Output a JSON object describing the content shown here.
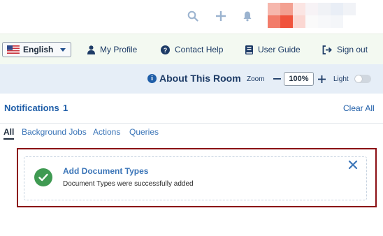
{
  "topbar": {
    "icons": [
      "search-icon",
      "plus-icon",
      "bell-icon"
    ],
    "avatar": "user-avatar"
  },
  "nav": {
    "language": "English",
    "language_flag": "us-flag-icon",
    "items": [
      {
        "label": "My Profile",
        "icon": "person-icon"
      },
      {
        "label": "Contact Help",
        "icon": "help-icon"
      },
      {
        "label": "User Guide",
        "icon": "book-icon"
      },
      {
        "label": "Sign out",
        "icon": "sign-out-icon"
      }
    ]
  },
  "room": {
    "about_label": "About This Room",
    "zoom_label": "Zoom",
    "zoom_value": "100%",
    "light_label": "Light",
    "light_on": false
  },
  "notifications": {
    "title": "Notifications",
    "count": "1",
    "clear_all": "Clear All",
    "tabs": [
      {
        "label": "All",
        "active": true
      },
      {
        "label": "Background Jobs",
        "active": false
      },
      {
        "label": "Actions",
        "active": false
      },
      {
        "label": "Queries",
        "active": false
      }
    ],
    "items": [
      {
        "title": "Add Document Types",
        "message": "Document Types were successfully added",
        "status": "success"
      }
    ]
  },
  "colors": {
    "primary": "#1f5ea8",
    "nav_bg": "#f3f9f1",
    "room_bg": "#e6eef7",
    "highlight": "#8b0f14",
    "success": "#3f9a52"
  }
}
